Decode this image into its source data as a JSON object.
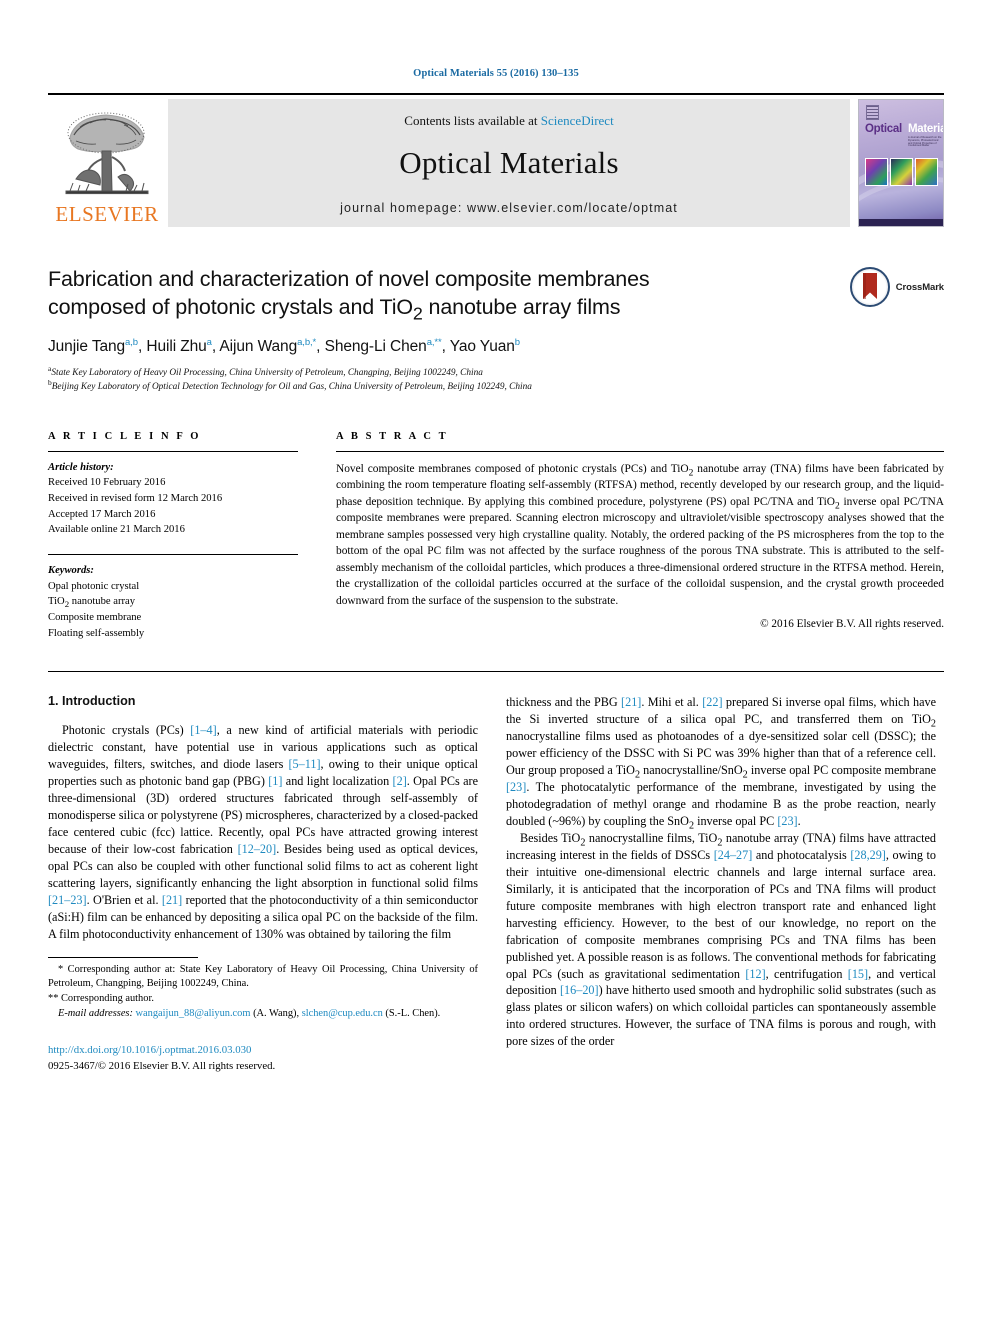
{
  "running_head": "Optical Materials 55 (2016) 130–135",
  "banner": {
    "publisher": "ELSEVIER",
    "contents_prefix": "Contents lists available at ",
    "contents_link": "ScienceDirect",
    "journal_title": "Optical Materials",
    "homepage": "journal homepage: www.elsevier.com/locate/optmat",
    "cover": {
      "title_part1": "Optical",
      "title_part2": "Materials",
      "subtitle": "A Journal of Research on the Dynamics, Photoelectronic and Optical Properties of Condensed Matter"
    }
  },
  "article": {
    "title": "Fabrication and characterization of novel composite membranes composed of photonic crystals and TiO2 nanotube array films",
    "title_line1": "Fabrication and characterization of novel composite membranes",
    "title_line2_a": "composed of photonic crystals and TiO",
    "title_line2_sub": "2",
    "title_line2_b": " nanotube array films",
    "crossmark_label": "CrossMark",
    "authors_plain": "Junjie Tang a,b, Huili Zhu a, Aijun Wang a,b,*, Sheng-Li Chen a,**, Yao Yuan b",
    "authors": [
      {
        "name": "Junjie Tang",
        "sup": "a,b",
        "sep": ", "
      },
      {
        "name": "Huili Zhu",
        "sup": "a",
        "sep": ", "
      },
      {
        "name": "Aijun Wang",
        "sup": "a,b,*",
        "sep": ", "
      },
      {
        "name": "Sheng-Li Chen",
        "sup": "a,**",
        "sep": ", "
      },
      {
        "name": "Yao Yuan",
        "sup": "b",
        "sep": ""
      }
    ],
    "affiliations": [
      {
        "mark": "a",
        "text": "State Key Laboratory of Heavy Oil Processing, China University of Petroleum, Changping, Beijing 1002249, China"
      },
      {
        "mark": "b",
        "text": "Beijing Key Laboratory of Optical Detection Technology for Oil and Gas, China University of Petroleum, Beijing 102249, China"
      }
    ]
  },
  "article_info": {
    "heading": "A R T I C L E   I N F O",
    "history_label": "Article history:",
    "history": [
      "Received 10 February 2016",
      "Received in revised form 12 March 2016",
      "Accepted 17 March 2016",
      "Available online 21 March 2016"
    ],
    "keywords_label": "Keywords:",
    "keywords_plain": [
      "Opal photonic crystal",
      "TiO2 nanotube array",
      "Composite membrane",
      "Floating self-assembly"
    ],
    "keyword_tio2_pre": "TiO",
    "keyword_tio2_sub": "2",
    "keyword_tio2_post": " nanotube array"
  },
  "abstract": {
    "heading": "A B S T R A C T",
    "text": "Novel composite membranes composed of photonic crystals (PCs) and TiO2 nanotube array (TNA) films have been fabricated by combining the room temperature floating self-assembly (RTFSA) method, recently developed by our research group, and the liquid-phase deposition technique. By applying this combined procedure, polystyrene (PS) opal PC/TNA and TiO2 inverse opal PC/TNA composite membranes were prepared. Scanning electron microscopy and ultraviolet/visible spectroscopy analyses showed that the membrane samples possessed very high crystalline quality. Notably, the ordered packing of the PS microspheres from the top to the bottom of the opal PC film was not affected by the surface roughness of the porous TNA substrate. This is attributed to the self-assembly mechanism of the colloidal particles, which produces a three-dimensional ordered structure in the RTFSA method. Herein, the crystallization of the colloidal particles occurred at the surface of the colloidal suspension, and the crystal growth proceeded downward from the surface of the suspension to the substrate.",
    "segments": [
      {
        "t": "Novel composite membranes composed of photonic crystals (PCs) and TiO"
      },
      {
        "t": "2",
        "sub": true
      },
      {
        "t": " nanotube array (TNA) films have been fabricated by combining the room temperature floating self-assembly (RTFSA) method, recently developed by our research group, and the liquid-phase deposition technique. By applying this combined procedure, polystyrene (PS) opal PC/TNA and TiO"
      },
      {
        "t": "2",
        "sub": true
      },
      {
        "t": " inverse opal PC/TNA composite membranes were prepared. Scanning electron microscopy and ultraviolet/visible spectroscopy analyses showed that the membrane samples possessed very high crystalline quality. Notably, the ordered packing of the PS microspheres from the top to the bottom of the opal PC film was not affected by the surface roughness of the porous TNA substrate. This is attributed to the self-assembly mechanism of the colloidal particles, which produces a three-dimensional ordered structure in the RTFSA method. Herein, the crystallization of the colloidal particles occurred at the surface of the colloidal suspension, and the crystal growth proceeded downward from the surface of the suspension to the substrate."
      }
    ],
    "copyright": "© 2016 Elsevier B.V. All rights reserved."
  },
  "section": {
    "number_title": "1. Introduction"
  },
  "left_column": {
    "paragraph1_plain": "Photonic crystals (PCs) [1–4], a new kind of artificial materials with periodic dielectric constant, have potential use in various applications such as optical waveguides, filters, switches, and diode lasers [5–11], owing to their unique optical properties such as photonic band gap (PBG) [1] and light localization [2]. Opal PCs are three-dimensional (3D) ordered structures fabricated through self-assembly of monodisperse silica or polystyrene (PS) microspheres, characterized by a closed-packed face centered cubic (fcc) lattice. Recently, opal PCs have attracted growing interest because of their low-cost fabrication [12–20]. Besides being used as optical devices, opal PCs can also be coupled with other functional solid films to act as coherent light scattering layers, significantly enhancing the light absorption in functional solid films [21–23]. O'Brien et al. [21] reported that the photoconductivity of a thin semiconductor (aSi:H) film can be enhanced by depositing a silica opal PC on the backside of the film. A film photoconductivity enhancement of 130% was obtained by tailoring the film",
    "paragraph1": [
      {
        "t": "Photonic crystals (PCs) "
      },
      {
        "t": "[1–4]",
        "ref": true
      },
      {
        "t": ", a new kind of artificial materials with periodic dielectric constant, have potential use in various applications such as optical waveguides, filters, switches, and diode lasers "
      },
      {
        "t": "[5–11]",
        "ref": true
      },
      {
        "t": ", owing to their unique optical properties such as photonic band gap (PBG) "
      },
      {
        "t": "[1]",
        "ref": true
      },
      {
        "t": " and light localization "
      },
      {
        "t": "[2]",
        "ref": true
      },
      {
        "t": ". Opal PCs are three-dimensional (3D) ordered structures fabricated through self-assembly of monodisperse silica or polystyrene (PS) microspheres, characterized by a closed-packed face centered cubic (fcc) lattice. Recently, opal PCs have attracted growing interest because of their low-cost fabrication "
      },
      {
        "t": "[12–20]",
        "ref": true
      },
      {
        "t": ". Besides being used as optical devices, opal PCs can also be coupled with other functional solid films to act as coherent light scattering layers, significantly enhancing the light absorption in functional solid films "
      },
      {
        "t": "[21–23]",
        "ref": true
      },
      {
        "t": ". O'Brien et al. "
      },
      {
        "t": "[21]",
        "ref": true
      },
      {
        "t": " reported that the photoconductivity of a thin semiconductor (aSi:H) film can be enhanced by depositing a silica opal PC on the backside of the film. A film photoconductivity enhancement of 130% was obtained by tailoring the film"
      }
    ]
  },
  "right_column": {
    "paragraph_a": [
      {
        "t": "thickness and the PBG "
      },
      {
        "t": "[21]",
        "ref": true
      },
      {
        "t": ". Mihi et al. "
      },
      {
        "t": "[22]",
        "ref": true
      },
      {
        "t": " prepared Si inverse opal films, which have the Si inverted structure of a silica opal PC, and transferred them on TiO"
      },
      {
        "t": "2",
        "sub": true
      },
      {
        "t": " nanocrystalline films used as photoanodes of a dye-sensitized solar cell (DSSC); the power efficiency of the DSSC with Si PC was 39% higher than that of a reference cell. Our group proposed a TiO"
      },
      {
        "t": "2",
        "sub": true
      },
      {
        "t": " nanocrystalline/SnO"
      },
      {
        "t": "2",
        "sub": true
      },
      {
        "t": " inverse opal PC composite membrane "
      },
      {
        "t": "[23]",
        "ref": true
      },
      {
        "t": ". The photocatalytic performance of the membrane, investigated by using the photodegradation of methyl orange and rhodamine B as the probe reaction, nearly doubled (~96%) by coupling the SnO"
      },
      {
        "t": "2",
        "sub": true
      },
      {
        "t": " inverse opal PC "
      },
      {
        "t": "[23]",
        "ref": true
      },
      {
        "t": "."
      }
    ],
    "paragraph_b": [
      {
        "t": "Besides TiO"
      },
      {
        "t": "2",
        "sub": true
      },
      {
        "t": " nanocrystalline films, TiO"
      },
      {
        "t": "2",
        "sub": true
      },
      {
        "t": " nanotube array (TNA) films have attracted increasing interest in the fields of DSSCs "
      },
      {
        "t": "[24–27]",
        "ref": true
      },
      {
        "t": " and photocatalysis "
      },
      {
        "t": "[28,29]",
        "ref": true
      },
      {
        "t": ", owing to their intuitive one-dimensional electric channels and large internal surface area. Similarly, it is anticipated that the incorporation of PCs and TNA films will product future composite membranes with high electron transport rate and enhanced light harvesting efficiency. However, to the best of our knowledge, no report on the fabrication of composite membranes comprising PCs and TNA films has been published yet. A possible reason is as follows. The conventional methods for fabricating opal PCs (such as gravitational sedimentation "
      },
      {
        "t": "[12]",
        "ref": true
      },
      {
        "t": ", centrifugation "
      },
      {
        "t": "[15]",
        "ref": true
      },
      {
        "t": ", and vertical deposition "
      },
      {
        "t": "[16–20]",
        "ref": true
      },
      {
        "t": ") have hitherto used smooth and hydrophilic solid substrates (such as glass plates or silicon wafers) on which colloidal particles can spontaneously assemble into ordered structures. However, the surface of TNA films is porous and rough, with pore sizes of the order"
      }
    ]
  },
  "footnotes": {
    "corresponding1_mark": "*",
    "corresponding1": "Corresponding author at: State Key Laboratory of Heavy Oil Processing, China University of Petroleum, Changping, Beijing 1002249, China.",
    "corresponding2_mark": "**",
    "corresponding2": "Corresponding author.",
    "email_label": "E-mail addresses:",
    "email1": "wangaijun_88@aliyun.com",
    "email1_owner": "(A. Wang)",
    "email2": "slchen@cup.edu.cn",
    "email2_owner": "(S.-L. Chen)."
  },
  "doi_block": {
    "doi": "http://dx.doi.org/10.1016/j.optmat.2016.03.030",
    "issn_line": "0925-3467/© 2016 Elsevier B.V. All rights reserved."
  },
  "colors": {
    "link": "#1f8ac0",
    "running_head": "#1a6aa2",
    "elsevier_orange": "#E87722",
    "banner_bg": "#e6e6e6"
  }
}
